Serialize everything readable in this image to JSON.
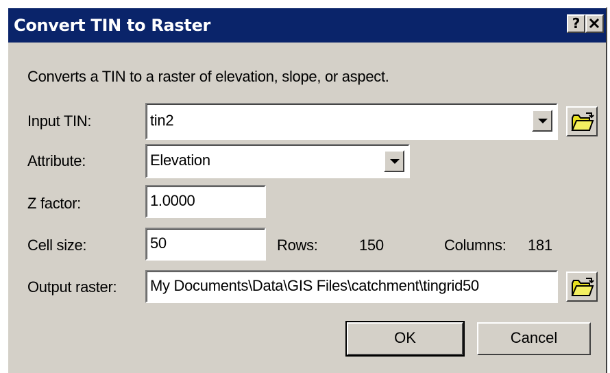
{
  "window": {
    "title": "Convert TIN to Raster",
    "help_label": "?",
    "close_label": "✕"
  },
  "description": "Converts a TIN to a raster of elevation, slope, or aspect.",
  "input_tin": {
    "label": "Input TIN:",
    "value": "tin2",
    "browse_icon": "open-folder-icon"
  },
  "attribute": {
    "label": "Attribute:",
    "value": "Elevation"
  },
  "z_factor": {
    "label": "Z factor:",
    "value": "1.0000"
  },
  "cell_size": {
    "label": "Cell size:",
    "value": "50",
    "rows_label": "Rows:",
    "rows_value": "150",
    "columns_label": "Columns:",
    "columns_value": "181"
  },
  "output_raster": {
    "label": "Output raster:",
    "value": "My Documents\\Data\\GIS Files\\catchment\\tingrid50",
    "browse_icon": "open-folder-icon"
  },
  "buttons": {
    "ok_label": "OK",
    "cancel_label": "Cancel"
  },
  "colors": {
    "titlebar": "#0a246a",
    "dialog_bg": "#d4d0c8",
    "folder_yellow": "#e8e020"
  }
}
